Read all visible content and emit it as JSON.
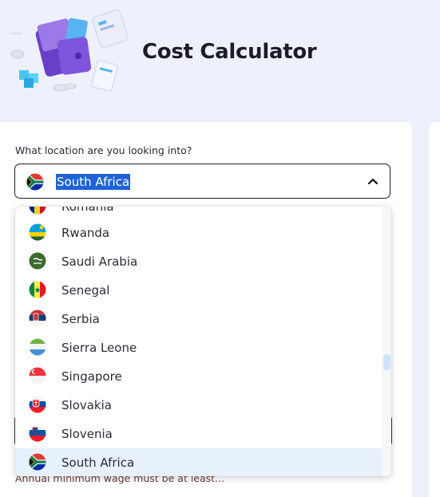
{
  "header": {
    "title": "Cost Calculator",
    "illustration_icon": "wallet-illustration-icon"
  },
  "location": {
    "question": "What location are you looking into?",
    "selected_value": "South Africa",
    "selected_flag_icon": "south-africa-flag-icon",
    "toggle_icon": "chevron-up-icon"
  },
  "dropdown": {
    "options": [
      {
        "label": "Romania",
        "flag_icon": "romania-flag-icon"
      },
      {
        "label": "Rwanda",
        "flag_icon": "rwanda-flag-icon"
      },
      {
        "label": "Saudi Arabia",
        "flag_icon": "saudi-arabia-flag-icon"
      },
      {
        "label": "Senegal",
        "flag_icon": "senegal-flag-icon"
      },
      {
        "label": "Serbia",
        "flag_icon": "serbia-flag-icon"
      },
      {
        "label": "Sierra Leone",
        "flag_icon": "sierra-leone-flag-icon"
      },
      {
        "label": "Singapore",
        "flag_icon": "singapore-flag-icon"
      },
      {
        "label": "Slovakia",
        "flag_icon": "slovakia-flag-icon"
      },
      {
        "label": "Slovenia",
        "flag_icon": "slovenia-flag-icon"
      },
      {
        "label": "South Africa",
        "flag_icon": "south-africa-flag-icon",
        "selected": true
      }
    ]
  },
  "behind": {
    "hint": "Annual minimum wage must be at least..."
  },
  "colors": {
    "page_bg": "#eef1fb",
    "selection_highlight": "#1e63d5",
    "selected_option_bg": "#e7f1fc"
  }
}
